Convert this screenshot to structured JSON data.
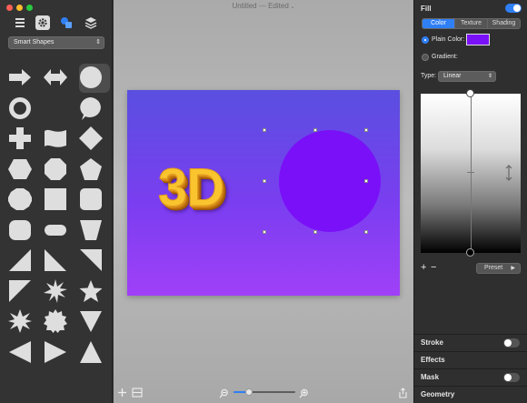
{
  "window": {
    "title": "Untitled",
    "status": "Edited"
  },
  "sidebar": {
    "shape_set": "Smart Shapes",
    "toolbar_icons": [
      "list-icon",
      "gear-icon",
      "shapes-icon",
      "layers-icon"
    ],
    "shapes": [
      "right-arrow",
      "double-arrow",
      "circle",
      "ring",
      "crescent",
      "speech-bubble",
      "cross",
      "wave-flag",
      "diamond",
      "hexagon",
      "octagon",
      "pentagon",
      "dodecagon",
      "square",
      "rounded-square",
      "rounded-rect",
      "pill",
      "trapezoid",
      "triangle-left",
      "triangle-corner",
      "right-triangle",
      "corner-triangle",
      "star-burst",
      "star",
      "star-8",
      "seal",
      "inverted-triangle",
      "left-triangle",
      "right-pointing-triangle",
      "triangle-up"
    ]
  },
  "canvas": {
    "text": "3D",
    "text_color": "#f9c42e",
    "circle_color": "#7a10f8",
    "bg_from": "#5a4fe0",
    "bg_to": "#a040f8"
  },
  "zoom": {
    "level_fraction": 0.25
  },
  "inspector": {
    "fill_label": "Fill",
    "fill_enabled": true,
    "tabs": [
      "Color",
      "Texture",
      "Shading"
    ],
    "active_tab": "Color",
    "plain_color_label": "Plain Color:",
    "plain_color": "#7a10f8",
    "gradient_label": "Gradient:",
    "type_label": "Type:",
    "type_value": "Linear",
    "preset_label": "Preset",
    "stroke_label": "Stroke",
    "effects_label": "Effects",
    "mask_label": "Mask",
    "geometry_label": "Geometry"
  }
}
